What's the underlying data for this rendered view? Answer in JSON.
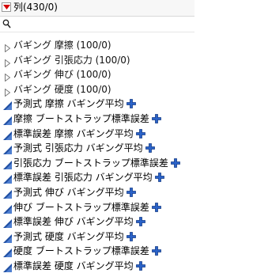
{
  "header": {
    "title": "列(430/0)",
    "menu_icon": "red-down-triangle-icon"
  },
  "search": {
    "icon": "search-icon",
    "placeholder": "",
    "value": ""
  },
  "groups": [
    {
      "label": "バギング 摩擦 (100/0)",
      "icon": "expand-triangle-icon"
    },
    {
      "label": "バギング 引張応力 (100/0)",
      "icon": "expand-triangle-icon"
    },
    {
      "label": "バギング 伸び (100/0)",
      "icon": "expand-triangle-icon"
    },
    {
      "label": "バギング 硬度 (100/0)",
      "icon": "expand-triangle-icon"
    }
  ],
  "columns": [
    {
      "label": "予測式 摩擦 バギング平均",
      "icon": "continuous-column-icon",
      "action_icon": "formula-plus-icon"
    },
    {
      "label": "摩擦 ブートストラップ標準誤差",
      "icon": "continuous-column-icon",
      "action_icon": "formula-plus-icon"
    },
    {
      "label": "標準誤差 摩擦 バギング平均",
      "icon": "continuous-column-icon",
      "action_icon": "formula-plus-icon"
    },
    {
      "label": "予測式 引張応力 バギング平均",
      "icon": "continuous-column-icon",
      "action_icon": "formula-plus-icon"
    },
    {
      "label": "引張応力 ブートストラップ標準誤差",
      "icon": "continuous-column-icon",
      "action_icon": "formula-plus-icon"
    },
    {
      "label": "標準誤差 引張応力 バギング平均",
      "icon": "continuous-column-icon",
      "action_icon": "formula-plus-icon"
    },
    {
      "label": "予測式 伸び バギング平均",
      "icon": "continuous-column-icon",
      "action_icon": "formula-plus-icon"
    },
    {
      "label": "伸び ブートストラップ標準誤差",
      "icon": "continuous-column-icon",
      "action_icon": "formula-plus-icon"
    },
    {
      "label": "標準誤差 伸び バギング平均",
      "icon": "continuous-column-icon",
      "action_icon": "formula-plus-icon"
    },
    {
      "label": "予測式 硬度 バギング平均",
      "icon": "continuous-column-icon",
      "action_icon": "formula-plus-icon"
    },
    {
      "label": "硬度 ブートストラップ標準誤差",
      "icon": "continuous-column-icon",
      "action_icon": "formula-plus-icon"
    },
    {
      "label": "標準誤差 硬度 バギング平均",
      "icon": "continuous-column-icon",
      "action_icon": "formula-plus-icon"
    }
  ],
  "colors": {
    "menu_triangle": "#d40000",
    "column_icon": "#1f4fa3",
    "plus_icon": "#2a62c8",
    "group_triangle": "#7a7a7a"
  }
}
